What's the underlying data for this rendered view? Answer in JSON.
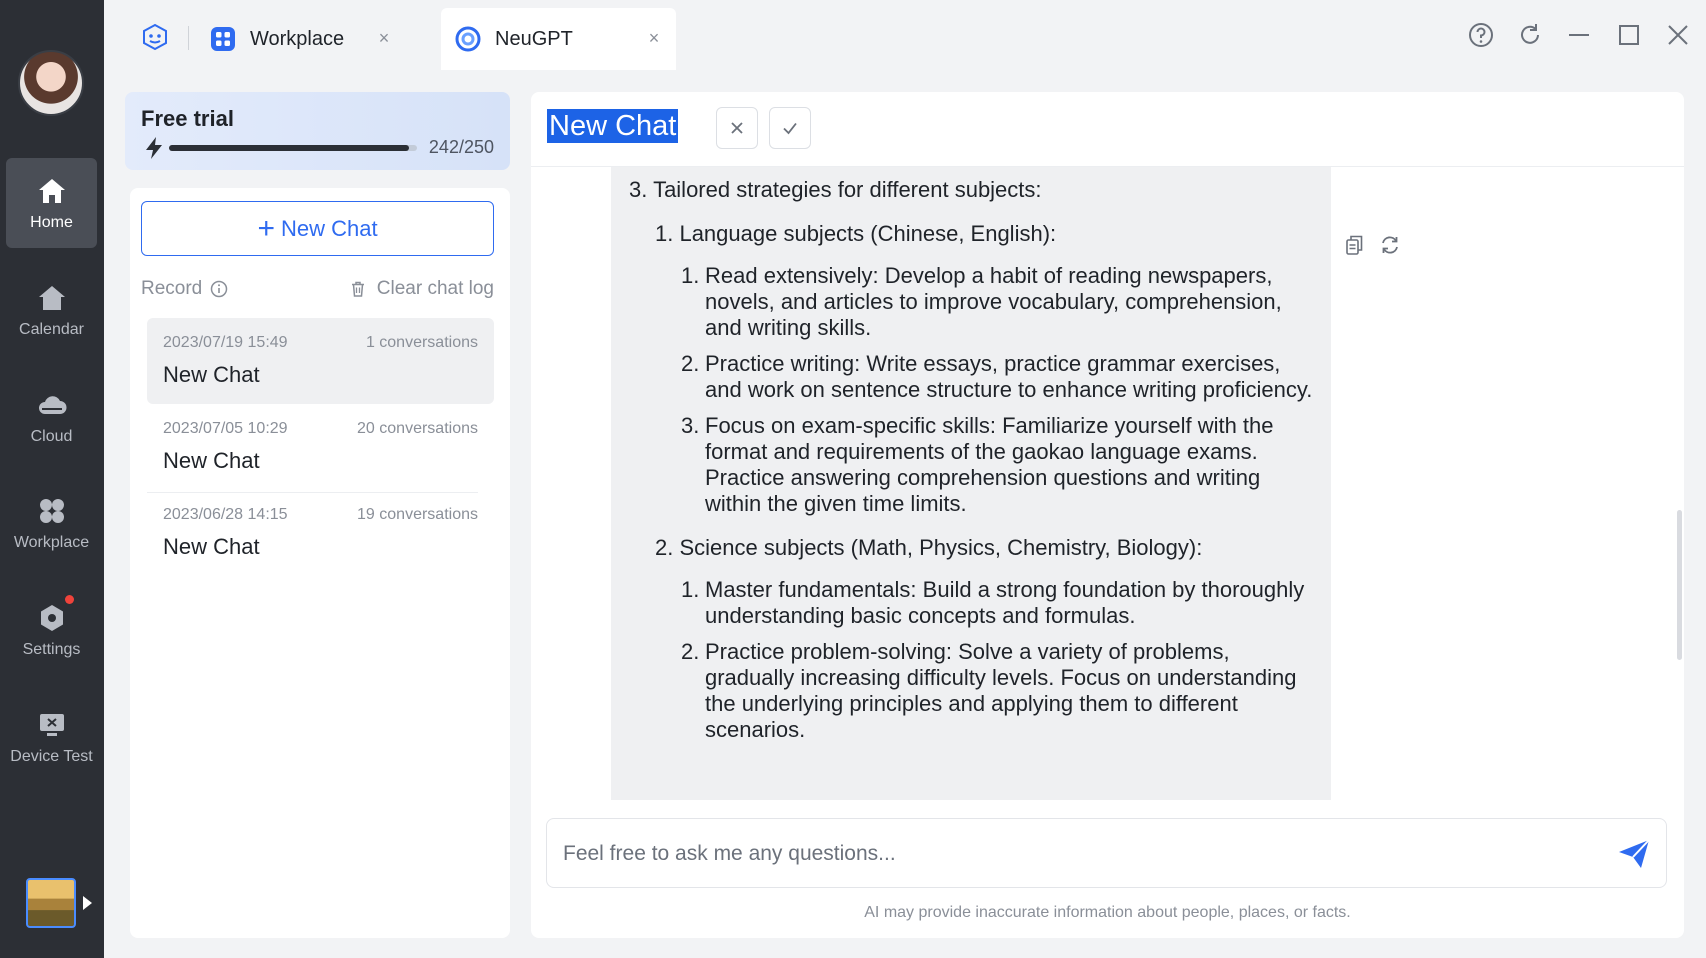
{
  "nav": {
    "items": [
      {
        "label": "Home",
        "icon": "home-icon"
      },
      {
        "label": "Calendar",
        "icon": "calendar-icon"
      },
      {
        "label": "Cloud",
        "icon": "cloud-icon"
      },
      {
        "label": "Workplace",
        "icon": "grid-icon"
      },
      {
        "label": "Settings",
        "icon": "settings-icon"
      },
      {
        "label": "Device Test",
        "icon": "device-test-icon"
      }
    ],
    "active": "Home"
  },
  "tabs": [
    {
      "label": "Workplace",
      "icon": "workplace-app-icon",
      "close": "×"
    },
    {
      "label": "NeuGPT",
      "icon": "neugpt-app-icon",
      "close": "×"
    }
  ],
  "trial": {
    "title": "Free trial",
    "used": 242,
    "total": 250,
    "count_text": "242/250",
    "progress": 0.968
  },
  "sidebar": {
    "new_chat_plus": "+",
    "new_chat_label": "New Chat",
    "record_label": "Record",
    "clear_label": "Clear chat log",
    "chats": [
      {
        "date": "2023/07/19 15:49",
        "count": "1 conversations",
        "title": "New Chat",
        "selected": true
      },
      {
        "date": "2023/07/05 10:29",
        "count": "20 conversations",
        "title": "New Chat",
        "selected": false
      },
      {
        "date": "2023/06/28 14:15",
        "count": "19 conversations",
        "title": "New Chat",
        "selected": false
      }
    ]
  },
  "main": {
    "title": "New Chat",
    "message": {
      "heading": "3. Tailored strategies for different subjects:",
      "sections": [
        {
          "title": "1. Language subjects (Chinese, English):",
          "items": [
            {
              "num": "1.",
              "text": "Read extensively: Develop a habit of reading newspapers, novels, and articles to improve vocabulary, comprehension, and writing skills."
            },
            {
              "num": "2.",
              "text": "Practice writing: Write essays, practice grammar exercises, and work on sentence structure to enhance writing proficiency."
            },
            {
              "num": "3.",
              "text": "Focus on exam-specific skills: Familiarize yourself with the format and requirements of the gaokao language exams. Practice answering comprehension questions and writing within the given time limits."
            }
          ]
        },
        {
          "title": "2. Science subjects (Math, Physics, Chemistry, Biology):",
          "items": [
            {
              "num": "1.",
              "text": "Master fundamentals: Build a strong foundation by thoroughly understanding basic concepts and formulas."
            },
            {
              "num": "2.",
              "text": "Practice problem-solving: Solve a variety of problems, gradually increasing difficulty levels. Focus on understanding the underlying principles and applying them to different scenarios."
            }
          ]
        }
      ]
    },
    "input_placeholder": "Feel free to ask me any questions...",
    "input_value": "",
    "disclaimer": "AI may provide inaccurate information about people, places, or facts."
  },
  "colors": {
    "accent": "#2f6bf0",
    "rail_bg": "#2c2f35",
    "selection": "#1d63e6",
    "notification_dot": "#f0433b"
  }
}
